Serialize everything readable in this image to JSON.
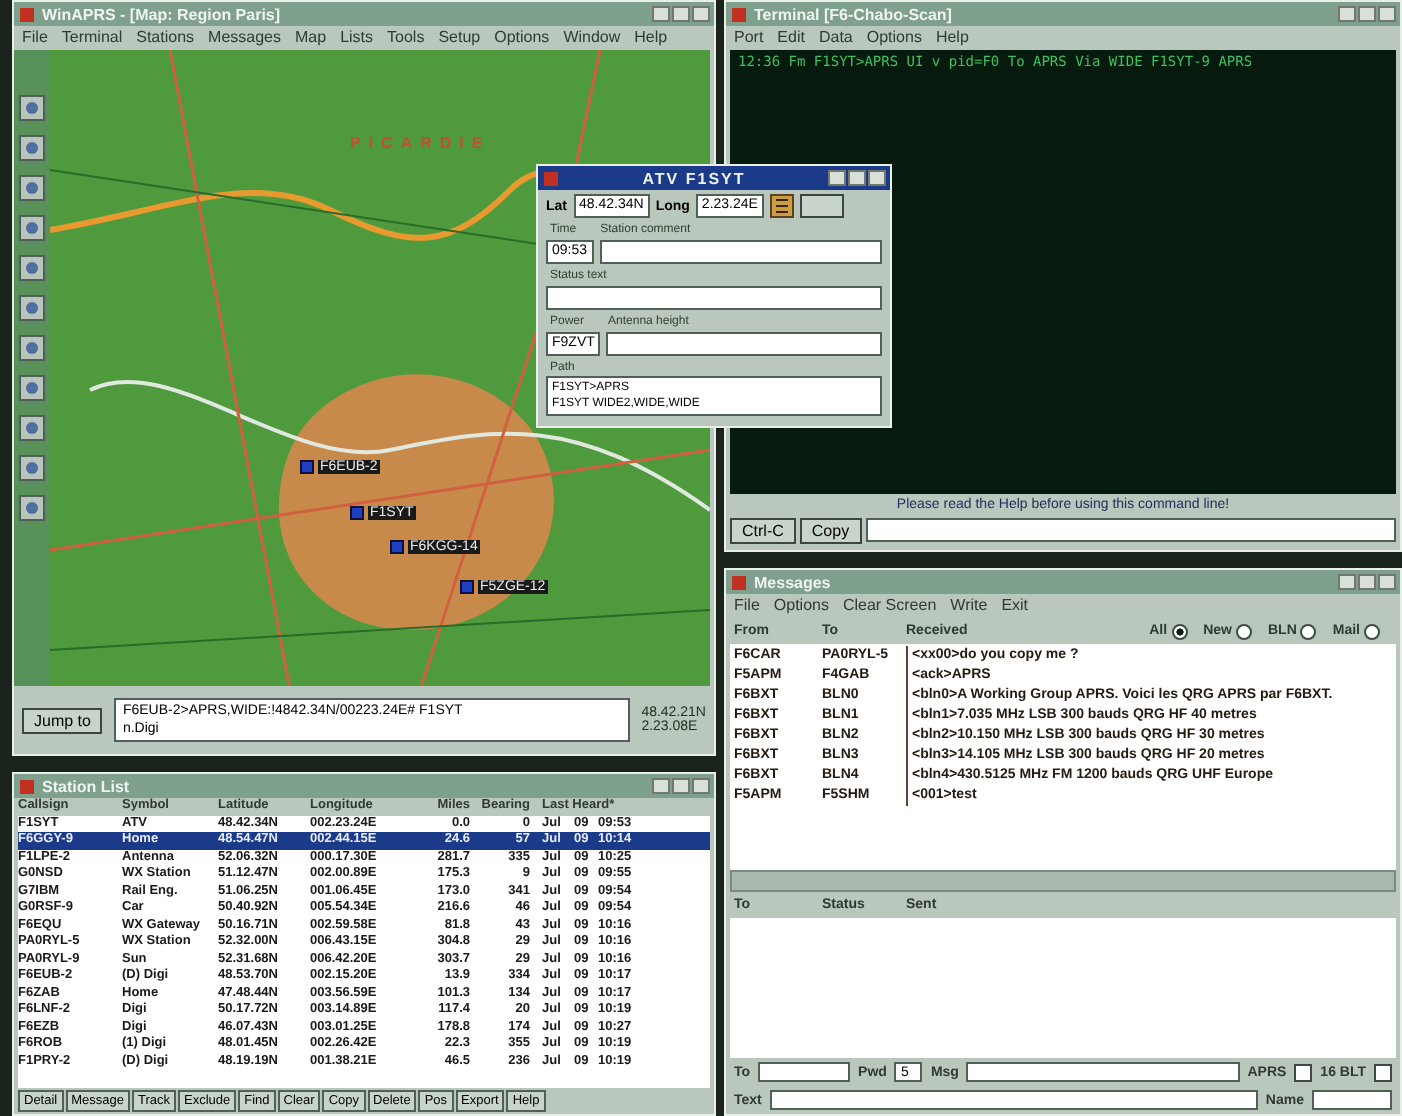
{
  "map_window": {
    "title": "WinAPRS - [Map: Region Paris]",
    "menu": [
      "File",
      "Terminal",
      "Stations",
      "Messages",
      "Map",
      "Lists",
      "Tools",
      "Setup",
      "Options",
      "Window",
      "Help"
    ],
    "map": {
      "region_label": "PICARDIE",
      "stations": [
        {
          "label": "F6EUB-2"
        },
        {
          "label": "F1SYT"
        },
        {
          "label": "F6KGG-14"
        },
        {
          "label": "F5ZGE-12"
        }
      ]
    },
    "jump_button": "Jump to",
    "path_text": [
      "F6EUB-2>APRS,WIDE:!4842.34N/00223.24E# F1SYT",
      "n.Digi"
    ],
    "lat": "48.42.21N",
    "long": "2.23.08E"
  },
  "dialog": {
    "title": "ATV F1SYT",
    "lat_label": "Lat",
    "lat": "48.42.34N",
    "long_label": "Long",
    "long": "2.23.24E",
    "fields": [
      {
        "label": "Time",
        "value": "09:53",
        "label2": "Station comment"
      },
      {
        "label": "Status text"
      },
      {
        "label": "Power",
        "value": "F9ZVT",
        "label2": "Antenna height"
      }
    ],
    "path_label": "Path",
    "path_lines": [
      "F1SYT>APRS",
      "F1SYT  WIDE2,WIDE,WIDE"
    ]
  },
  "terminal": {
    "title": "Terminal [F6-Chabo-Scan]",
    "menu": [
      "Port",
      "Edit",
      "Data",
      "Options",
      "Help"
    ],
    "lines": [
      "12:36 Fm F1SYT>APRS  UI v pid=F0  To APRS Via WIDE  F1SYT-9   APRS"
    ],
    "notice": "Please read the Help before using this command line!",
    "buttons": [
      "Ctrl-C",
      "Copy"
    ]
  },
  "messages": {
    "title": "Messages",
    "menu": [
      "File",
      "Options",
      "Clear Screen",
      "Write",
      "Exit"
    ],
    "columns": [
      "From",
      "To",
      "Received"
    ],
    "filters": [
      {
        "label": "All",
        "selected": true
      },
      {
        "label": "New",
        "selected": false
      },
      {
        "label": "BLN",
        "selected": false
      },
      {
        "label": "Mail",
        "selected": false
      }
    ],
    "rows": [
      {
        "from": "F6CAR",
        "to": "PA0RYL-5",
        "text": "<xx00>do you copy me ?"
      },
      {
        "from": "F5APM",
        "to": "F4GAB",
        "text": "<ack>APRS"
      },
      {
        "from": "F6BXT",
        "to": "BLN0",
        "text": "<bln0>A Working Group APRS. Voici les QRG APRS par F6BXT."
      },
      {
        "from": "F6BXT",
        "to": "BLN1",
        "text": "<bln1>7.035 MHz LSB 300 bauds QRG HF 40 metres"
      },
      {
        "from": "F6BXT",
        "to": "BLN2",
        "text": "<bln2>10.150 MHz LSB 300 bauds QRG HF 30 metres"
      },
      {
        "from": "F6BXT",
        "to": "BLN3",
        "text": "<bln3>14.105 MHz LSB 300 bauds QRG HF 20 metres"
      },
      {
        "from": "F6BXT",
        "to": "BLN4",
        "text": "<bln4>430.5125 MHz FM 1200 bauds QRG UHF Europe"
      },
      {
        "from": "F5APM",
        "to": "F5SHM",
        "text": "<001>test"
      }
    ],
    "sent_columns": [
      "To",
      "Status",
      "Sent"
    ],
    "form": {
      "to_label": "To",
      "pwd_label": "Pwd",
      "pwd": "5",
      "msg_label": "Msg",
      "aprs_label": "APRS",
      "aprs_checked": false,
      "bln_label": "16 BLT",
      "bln_checked": false,
      "text_label": "Text",
      "name_label": "Name"
    }
  },
  "stations": {
    "title": "Station List",
    "columns": [
      "Callsign",
      "Symbol",
      "Latitude",
      "Longitude",
      "Miles",
      "Bearing",
      "Last Heard*"
    ],
    "rows": [
      {
        "selected": false,
        "cells": [
          "F1SYT",
          "ATV",
          "48.42.34N",
          "002.23.24E",
          "0.0",
          "0",
          "Jul",
          "09",
          "09:53"
        ]
      },
      {
        "selected": true,
        "cells": [
          "F6GGY-9",
          "Home",
          "48.54.47N",
          "002.44.15E",
          "24.6",
          "57",
          "Jul",
          "09",
          "10:14"
        ]
      },
      {
        "selected": false,
        "cells": [
          "F1LPE-2",
          "Antenna",
          "52.06.32N",
          "000.17.30E",
          "281.7",
          "335",
          "Jul",
          "09",
          "10:25"
        ]
      },
      {
        "selected": false,
        "cells": [
          "G0NSD",
          "WX Station",
          "51.12.47N",
          "002.00.89E",
          "175.3",
          "9",
          "Jul",
          "09",
          "09:55"
        ]
      },
      {
        "selected": false,
        "cells": [
          "G7IBM",
          "Rail Eng.",
          "51.06.25N",
          "001.06.45E",
          "173.0",
          "341",
          "Jul",
          "09",
          "09:54"
        ]
      },
      {
        "selected": false,
        "cells": [
          "G0RSF-9",
          "Car",
          "50.40.92N",
          "005.54.34E",
          "216.6",
          "46",
          "Jul",
          "09",
          "09:54"
        ]
      },
      {
        "selected": false,
        "cells": [
          "F6EQU",
          "WX Gateway",
          "50.16.71N",
          "002.59.58E",
          "81.8",
          "43",
          "Jul",
          "09",
          "10:16"
        ]
      },
      {
        "selected": false,
        "cells": [
          "PA0RYL-5",
          "WX Station",
          "52.32.00N",
          "006.43.15E",
          "304.8",
          "29",
          "Jul",
          "09",
          "10:16"
        ]
      },
      {
        "selected": false,
        "cells": [
          "PA0RYL-9",
          "Sun",
          "52.31.68N",
          "006.42.20E",
          "303.7",
          "29",
          "Jul",
          "09",
          "10:16"
        ]
      },
      {
        "selected": false,
        "cells": [
          "F6EUB-2",
          "(D) Digi",
          "48.53.70N",
          "002.15.20E",
          "13.9",
          "334",
          "Jul",
          "09",
          "10:17"
        ]
      },
      {
        "selected": false,
        "cells": [
          "F6ZAB",
          "Home",
          "47.48.44N",
          "003.56.59E",
          "101.3",
          "134",
          "Jul",
          "09",
          "10:17"
        ]
      },
      {
        "selected": false,
        "cells": [
          "F6LNF-2",
          "Digi",
          "50.17.72N",
          "003.14.89E",
          "117.4",
          "20",
          "Jul",
          "09",
          "10:19"
        ]
      },
      {
        "selected": false,
        "cells": [
          "F6EZB",
          "Digi",
          "46.07.43N",
          "003.01.25E",
          "178.8",
          "174",
          "Jul",
          "09",
          "10:27"
        ]
      },
      {
        "selected": false,
        "cells": [
          "F6ROB",
          "(1) Digi",
          "48.01.45N",
          "002.26.42E",
          "22.3",
          "355",
          "Jul",
          "09",
          "10:19"
        ]
      },
      {
        "selected": false,
        "cells": [
          "F1PRY-2",
          "(D) Digi",
          "48.19.19N",
          "001.38.21E",
          "46.5",
          "236",
          "Jul",
          "09",
          "10:19"
        ]
      }
    ],
    "tabs": [
      {
        "label": "Detail"
      },
      {
        "label": "Message"
      },
      {
        "label": "Track"
      },
      {
        "label": "Exclude"
      },
      {
        "label": "Find"
      },
      {
        "label": "Clear"
      },
      {
        "label": "Copy"
      },
      {
        "label": "Delete"
      },
      {
        "label": "Pos"
      },
      {
        "label": "Export"
      },
      {
        "label": "Help"
      }
    ]
  }
}
